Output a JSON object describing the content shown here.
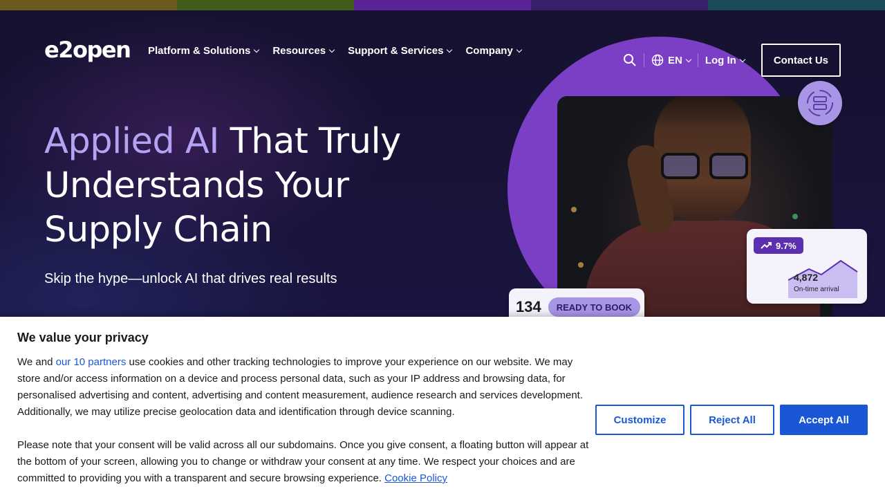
{
  "colors": {
    "topbar": [
      "#6b5a1e",
      "#3f5e1a",
      "#5a2499",
      "#3a1f6b",
      "#1d4a5a"
    ],
    "accent_text": "#b3a3f2",
    "brand_purple": "#7a3fc4",
    "consent_blue": "#1a57d6"
  },
  "nav": {
    "logo": "e2open",
    "links": [
      {
        "label": "Platform & Solutions"
      },
      {
        "label": "Resources"
      },
      {
        "label": "Support & Services"
      },
      {
        "label": "Company"
      }
    ],
    "lang": "EN",
    "login": "Log In",
    "contact": "Contact Us",
    "icons": [
      "search-icon",
      "globe-icon",
      "chevron-down-icon"
    ]
  },
  "hero": {
    "headline_accent": "Applied AI",
    "headline_rest_1": " That Truly",
    "headline_line_2": "Understands Your",
    "headline_line_3": "Supply Chain",
    "subhead": "Skip the hype—unlock AI that drives real results",
    "stat_card": {
      "change": "9.7%",
      "value": "4,872",
      "label": "On-time arrival"
    },
    "book_card": {
      "count": "134",
      "status": "READY TO BOOK"
    }
  },
  "consent": {
    "title": "We value your privacy",
    "p1_before": "We and ",
    "p1_link": "our 10 partners",
    "p1_after": " use cookies and other tracking technologies to improve your experience on our website. We may store and/or access information on a device and process personal data, such as your IP address and browsing data, for personalised advertising and content, advertising and content measurement, audience research and services development. Additionally, we may utilize precise geolocation data and identification through device scanning.",
    "p2": "Please note that your consent will be valid across all our subdomains. Once you give consent, a floating button will appear at the bottom of your screen, allowing you to change or withdraw your consent at any time. We respect your choices and are committed to providing you with a transparent and secure browsing experience. ",
    "p2_link": "Cookie Policy",
    "buttons": {
      "customize": "Customize",
      "reject": "Reject All",
      "accept": "Accept All"
    }
  }
}
